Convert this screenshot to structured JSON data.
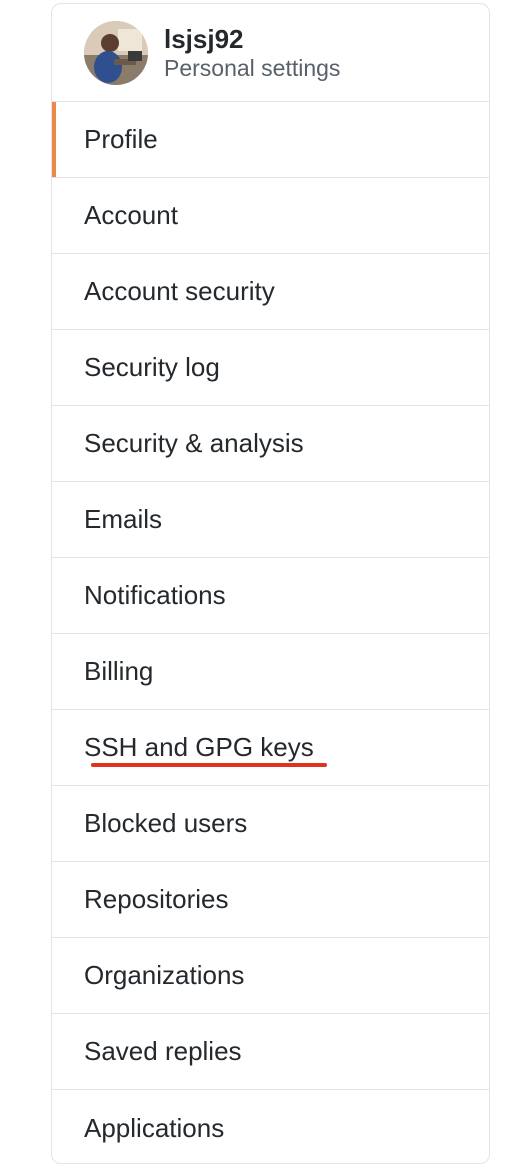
{
  "header": {
    "username": "lsjsj92",
    "subtitle": "Personal settings",
    "avatar_icon": "user-avatar-photo"
  },
  "nav": {
    "items": [
      {
        "label": "Profile",
        "selected": true
      },
      {
        "label": "Account"
      },
      {
        "label": "Account security"
      },
      {
        "label": "Security log"
      },
      {
        "label": "Security & analysis"
      },
      {
        "label": "Emails"
      },
      {
        "label": "Notifications"
      },
      {
        "label": "Billing"
      },
      {
        "label": "SSH and GPG keys",
        "highlighted": true
      },
      {
        "label": "Blocked users"
      },
      {
        "label": "Repositories"
      },
      {
        "label": "Organizations"
      },
      {
        "label": "Saved replies"
      },
      {
        "label": "Applications"
      }
    ]
  },
  "colors": {
    "selected_indicator": "#e36209",
    "highlight_underline": "#e0321e",
    "border": "#e1e4e8",
    "text": "#24292e",
    "muted_text": "#586069"
  }
}
